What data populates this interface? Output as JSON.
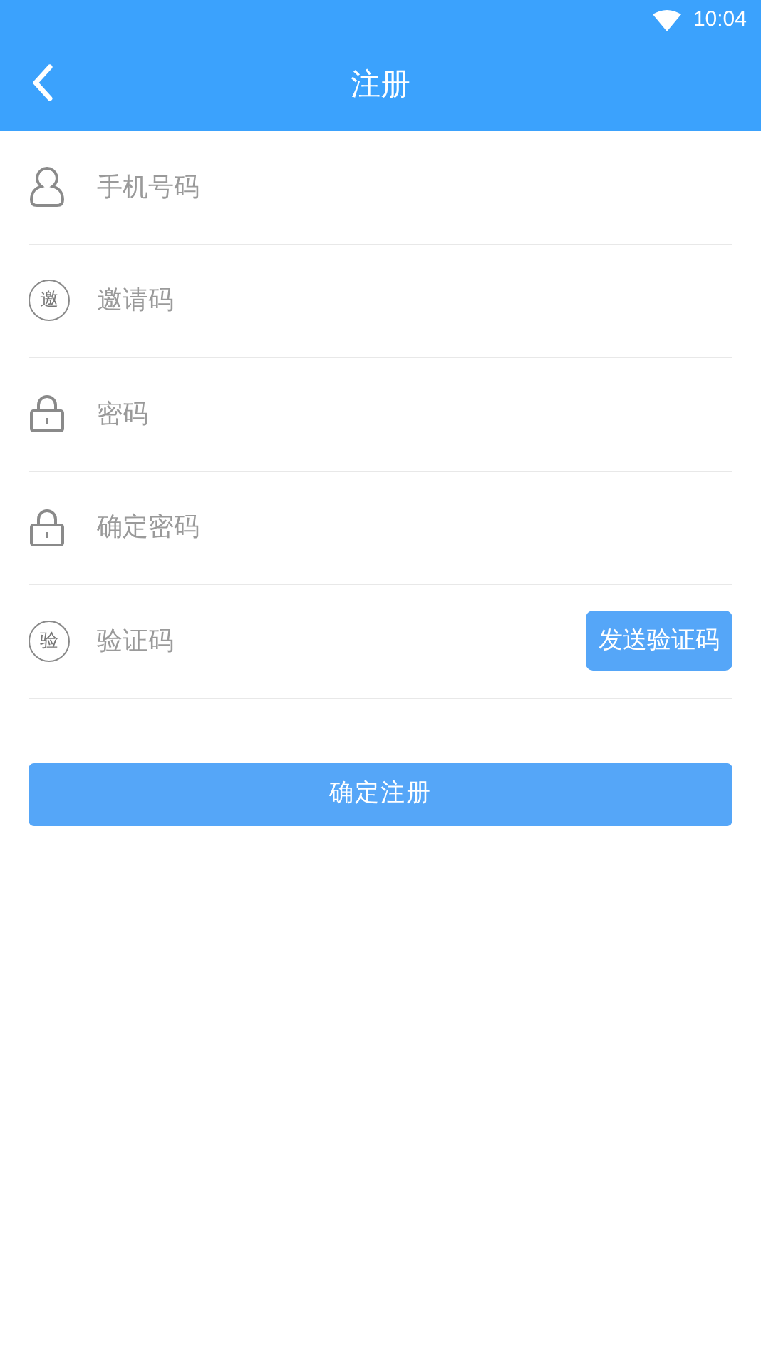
{
  "status_bar": {
    "time": "10:04"
  },
  "header": {
    "title": "注册"
  },
  "fields": [
    {
      "kind": "person",
      "placeholder": "手机号码"
    },
    {
      "kind": "badge",
      "icon_text": "邀",
      "placeholder": "邀请码"
    },
    {
      "kind": "lock",
      "placeholder": "密码"
    },
    {
      "kind": "lock",
      "placeholder": "确定密码"
    },
    {
      "kind": "badge",
      "icon_text": "验",
      "placeholder": "验证码",
      "button": "发送验证码"
    }
  ],
  "submit_button": "确定注册"
}
